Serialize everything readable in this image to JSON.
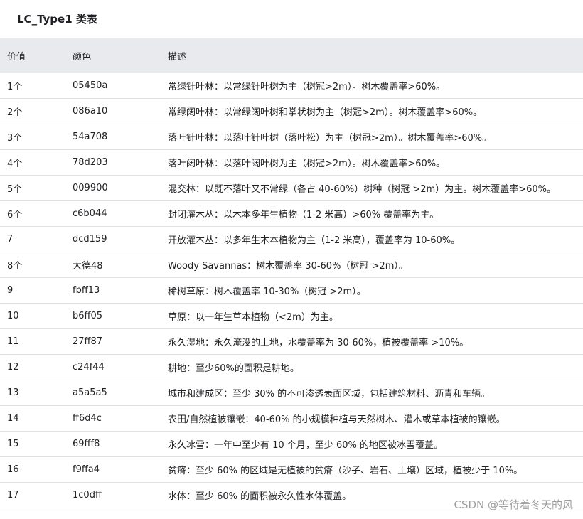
{
  "title": "LC_Type1 类表",
  "headers": [
    "价值",
    "颜色",
    "描述"
  ],
  "rows": [
    [
      "1个",
      "05450a",
      "常绿针叶林：以常绿针叶树为主（树冠>2m）。树木覆盖率>60%。"
    ],
    [
      "2个",
      "086a10",
      "常绿阔叶林：以常绿阔叶树和掌状树为主（树冠>2m）。树木覆盖率>60%。"
    ],
    [
      "3个",
      "54a708",
      "落叶针叶林：以落叶针叶树（落叶松）为主（树冠>2m）。树木覆盖率>60%。"
    ],
    [
      "4个",
      "78d203",
      "落叶阔叶林：以落叶阔叶树为主（树冠>2m）。树木覆盖率>60%。"
    ],
    [
      "5个",
      "009900",
      "混交林：以既不落叶又不常绿（各占 40-60%）树种（树冠 >2m）为主。树木覆盖率>60%。"
    ],
    [
      "6个",
      "c6b044",
      "封闭灌木丛：以木本多年生植物（1-2 米高）>60% 覆盖率为主。"
    ],
    [
      "7",
      "dcd159",
      "开放灌木丛：以多年生木本植物为主（1-2 米高），覆盖率为 10-60%。"
    ],
    [
      "8个",
      "大德48",
      "Woody Savannas：树木覆盖率 30-60%（树冠 >2m）。"
    ],
    [
      "9",
      "fbff13",
      "稀树草原：树木覆盖率 10-30%（树冠 >2m）。"
    ],
    [
      "10",
      "b6ff05",
      "草原：以一年生草本植物（<2m）为主。"
    ],
    [
      "11",
      "27ff87",
      "永久湿地：永久淹没的土地，水覆盖率为 30-60%，植被覆盖率 >10%。"
    ],
    [
      "12",
      "c24f44",
      "耕地：至少60%的面积是耕地。"
    ],
    [
      "13",
      "a5a5a5",
      "城市和建成区：至少 30% 的不可渗透表面区域，包括建筑材料、沥青和车辆。"
    ],
    [
      "14",
      "ff6d4c",
      "农田/自然植被镶嵌：40-60% 的小规模种植与天然树木、灌木或草本植被的镶嵌。"
    ],
    [
      "15",
      "69fff8",
      "永久冰雪：一年中至少有 10 个月，至少 60% 的地区被冰雪覆盖。"
    ],
    [
      "16",
      "f9ffa4",
      "贫瘠：至少 60% 的区域是无植被的贫瘠（沙子、岩石、土壤）区域，植被少于 10%。"
    ],
    [
      "17",
      "1c0dff",
      "水体：至少 60% 的面积被永久性水体覆盖。"
    ]
  ],
  "watermark": "CSDN @等待着冬天的风"
}
